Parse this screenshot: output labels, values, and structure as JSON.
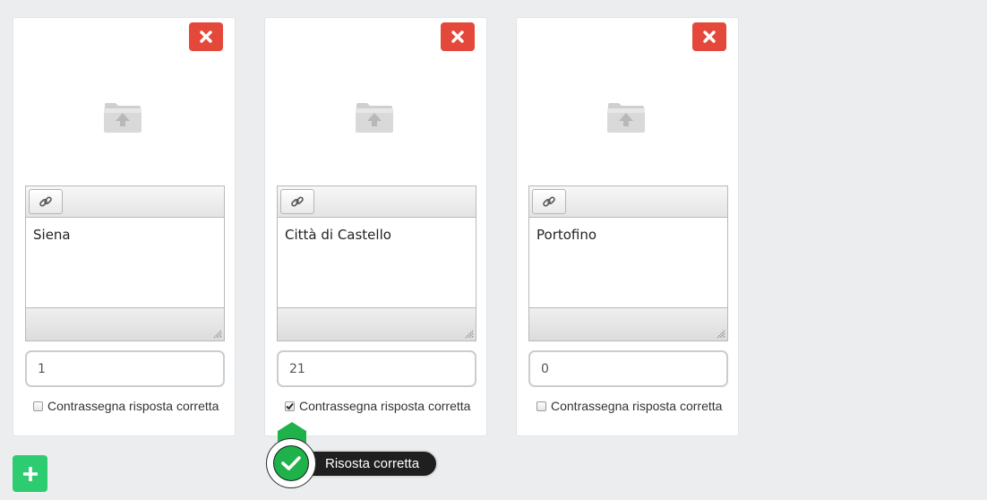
{
  "cards": [
    {
      "answer_text": "Siena",
      "score": "1",
      "checkbox_label": "Contrassegna risposta corretta",
      "checked": false
    },
    {
      "answer_text": "Città di Castello",
      "score": "21",
      "checkbox_label": "Contrassegna risposta corretta",
      "checked": true
    },
    {
      "answer_text": "Portofino",
      "score": "0",
      "checkbox_label": "Contrassegna risposta corretta",
      "checked": false
    }
  ],
  "tooltip": {
    "text": "Risosta corretta"
  },
  "icons": {
    "delete": "close-icon",
    "upload": "folder-upload-icon",
    "link": "link-icon",
    "add": "plus-icon",
    "check": "checkmark-icon"
  },
  "colors": {
    "delete_button": "#e4483a",
    "add_button": "#2ecc71",
    "tooltip_badge": "#1fb24a",
    "tooltip_bg": "#1f1f1f"
  }
}
